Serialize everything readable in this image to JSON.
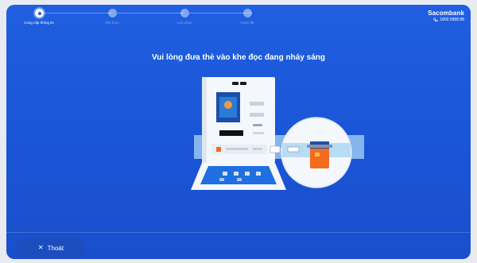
{
  "brand": {
    "name": "Sacombank",
    "hotline": "1800 5858 88"
  },
  "stepper": {
    "steps": [
      {
        "label": "Cung cấp thông tin",
        "state": "active"
      },
      {
        "label": "Xác thực",
        "state": "pending"
      },
      {
        "label": "Lựa chọn",
        "state": "pending"
      },
      {
        "label": "Hoàn tất",
        "state": "pending"
      }
    ]
  },
  "instruction": "Vui lòng đưa thẻ vào khe đọc đang nháy sáng",
  "footer": {
    "exit_label": "Thoát"
  },
  "colors": {
    "background": "#1f5fe0",
    "accent_orange": "#f26b1f",
    "highlight_band": "#a9d4f5",
    "card_blue": "#2a7bd8"
  },
  "icons": [
    "phone-icon",
    "close-icon"
  ]
}
